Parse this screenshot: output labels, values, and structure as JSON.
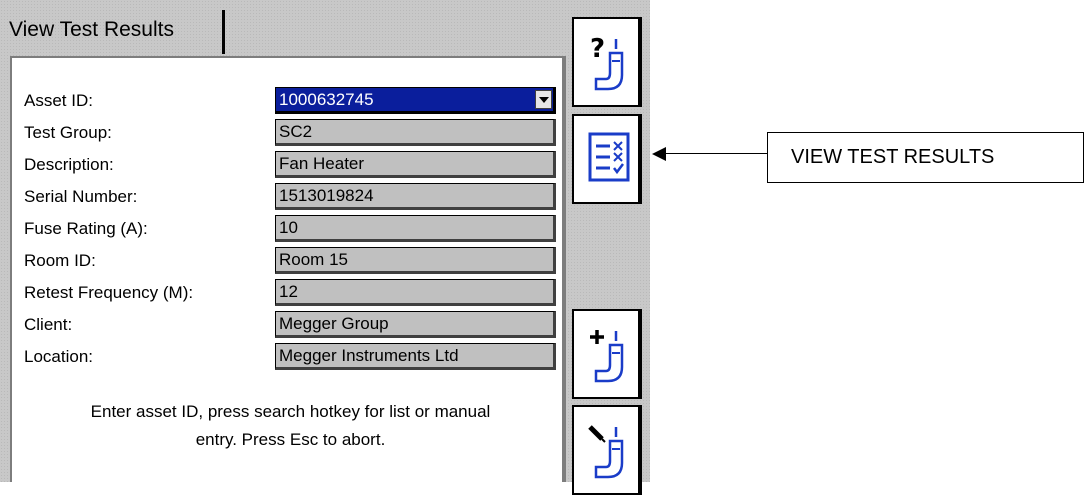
{
  "tab": {
    "label": "View Test Results"
  },
  "form": {
    "fields": [
      {
        "label": "Asset ID:",
        "value": "1000632745"
      },
      {
        "label": "Test Group:",
        "value": "SC2"
      },
      {
        "label": "Description:",
        "value": "Fan Heater"
      },
      {
        "label": "Serial Number:",
        "value": "1513019824"
      },
      {
        "label": "Fuse Rating (A):",
        "value": "10"
      },
      {
        "label": "Room ID:",
        "value": "Room 15"
      },
      {
        "label": "Retest Frequency (M):",
        "value": "12"
      },
      {
        "label": "Client:",
        "value": "Megger Group"
      },
      {
        "label": "Location:",
        "value": "Megger Instruments Ltd"
      }
    ],
    "hint_line1": "Enter asset ID, press search hotkey for list or manual",
    "hint_line2": "entry. Press Esc to abort."
  },
  "sidebar": {
    "keys": [
      {
        "icon": "help-probe-icon"
      },
      {
        "icon": "view-results-checklist-icon"
      },
      {
        "icon": "add-probe-icon"
      },
      {
        "icon": "edit-probe-icon"
      }
    ]
  },
  "annotation": {
    "label": "VIEW TEST RESULTS"
  },
  "colors": {
    "selected_bg": "#0a1e9c",
    "icon_blue": "#1a3cc8",
    "field_bg": "#c0c0c0"
  }
}
